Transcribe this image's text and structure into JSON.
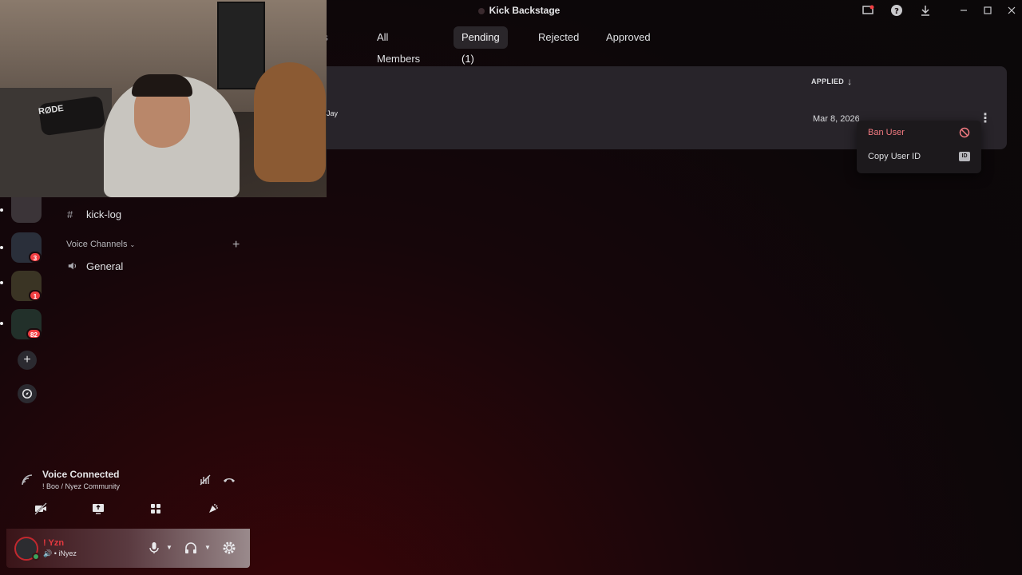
{
  "window": {
    "title": "Kick Backstage"
  },
  "tabs": [
    {
      "label": "rs"
    },
    {
      "label": "All Members"
    },
    {
      "label": "Pending (1)"
    },
    {
      "label": "Rejected"
    },
    {
      "label": "Approved"
    }
  ],
  "members_table": {
    "sort_column": "APPLIED",
    "rows": [
      {
        "name": "Jay",
        "applied": "Mar 8, 2026"
      }
    ]
  },
  "context_menu": {
    "items": [
      {
        "label": "Ban User",
        "icon": "ban-icon",
        "color": "#f27a80"
      },
      {
        "label": "Copy User ID",
        "icon": "id-icon",
        "badge": "ID"
      }
    ]
  },
  "server_rail": {
    "badges": [
      "3",
      "1",
      "82"
    ]
  },
  "channels": {
    "text": [
      {
        "name": "kick-log"
      }
    ],
    "voice_category": "Voice Channels",
    "voice": [
      {
        "name": "General"
      }
    ]
  },
  "voice_status": {
    "title": "Voice Connected",
    "subtitle": "! Boo / Nyez Community"
  },
  "user": {
    "name": "! Yzn",
    "tag": "iNyez",
    "status_color": "#3ba55d"
  },
  "webcam": {
    "mic_brand": "RØDE"
  }
}
